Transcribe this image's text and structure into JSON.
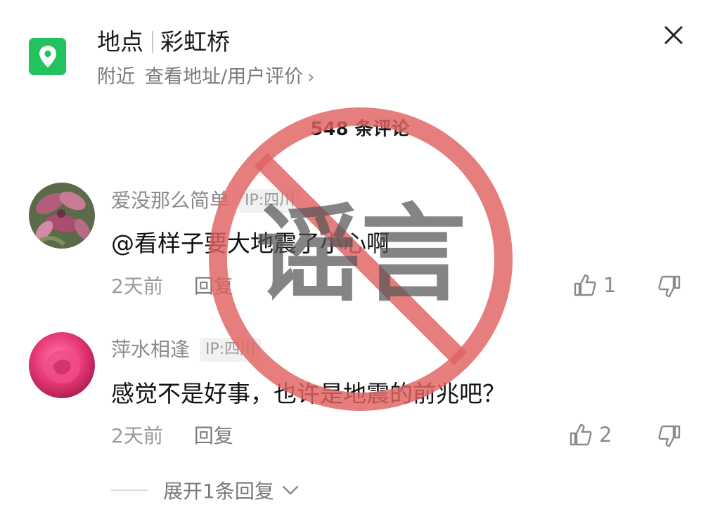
{
  "header": {
    "title_prefix": "地点",
    "title_place": "彩虹桥",
    "subtitle_near": "附近",
    "subtitle_link": "查看地址/用户评价"
  },
  "comments_count": "548 条评论",
  "comments": [
    {
      "username": "爱没那么简单",
      "ip": "IP:四川",
      "text": "@看样子要大地震了小心啊",
      "time": "2天前",
      "reply": "回复",
      "likes": "1"
    },
    {
      "username": "萍水相逢",
      "ip": "IP:四川",
      "text": "感觉不是好事，也许是地震的前兆吧？",
      "time": "2天前",
      "reply": "回复",
      "likes": "2"
    }
  ],
  "expand_replies": "展开1条回复",
  "stamp_text": "谣言",
  "colors": {
    "location_green": "#22c25e",
    "stamp_red": "#e06262"
  },
  "icons": [
    "location-pin-icon",
    "close-icon",
    "chevron-right-icon",
    "thumbs-up-icon",
    "thumbs-down-icon",
    "chevron-down-icon"
  ]
}
